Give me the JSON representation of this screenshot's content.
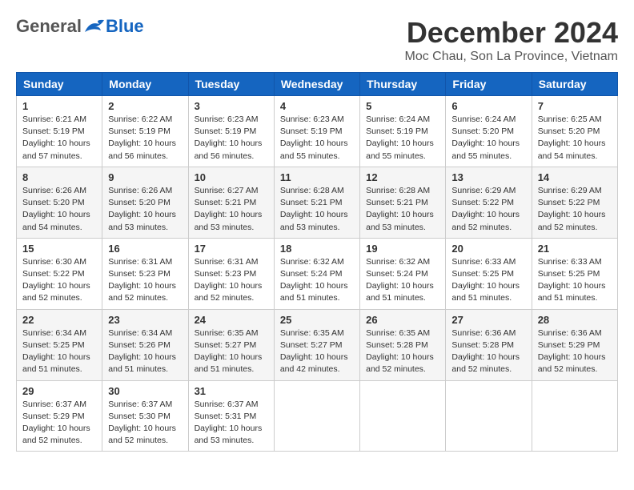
{
  "header": {
    "logo_general": "General",
    "logo_blue": "Blue",
    "title": "December 2024",
    "subtitle": "Moc Chau, Son La Province, Vietnam"
  },
  "weekdays": [
    "Sunday",
    "Monday",
    "Tuesday",
    "Wednesday",
    "Thursday",
    "Friday",
    "Saturday"
  ],
  "weeks": [
    [
      {
        "day": 1,
        "sunrise": "6:21 AM",
        "sunset": "5:19 PM",
        "daylight": "10 hours and 57 minutes."
      },
      {
        "day": 2,
        "sunrise": "6:22 AM",
        "sunset": "5:19 PM",
        "daylight": "10 hours and 56 minutes."
      },
      {
        "day": 3,
        "sunrise": "6:23 AM",
        "sunset": "5:19 PM",
        "daylight": "10 hours and 56 minutes."
      },
      {
        "day": 4,
        "sunrise": "6:23 AM",
        "sunset": "5:19 PM",
        "daylight": "10 hours and 55 minutes."
      },
      {
        "day": 5,
        "sunrise": "6:24 AM",
        "sunset": "5:19 PM",
        "daylight": "10 hours and 55 minutes."
      },
      {
        "day": 6,
        "sunrise": "6:24 AM",
        "sunset": "5:20 PM",
        "daylight": "10 hours and 55 minutes."
      },
      {
        "day": 7,
        "sunrise": "6:25 AM",
        "sunset": "5:20 PM",
        "daylight": "10 hours and 54 minutes."
      }
    ],
    [
      {
        "day": 8,
        "sunrise": "6:26 AM",
        "sunset": "5:20 PM",
        "daylight": "10 hours and 54 minutes."
      },
      {
        "day": 9,
        "sunrise": "6:26 AM",
        "sunset": "5:20 PM",
        "daylight": "10 hours and 53 minutes."
      },
      {
        "day": 10,
        "sunrise": "6:27 AM",
        "sunset": "5:21 PM",
        "daylight": "10 hours and 53 minutes."
      },
      {
        "day": 11,
        "sunrise": "6:28 AM",
        "sunset": "5:21 PM",
        "daylight": "10 hours and 53 minutes."
      },
      {
        "day": 12,
        "sunrise": "6:28 AM",
        "sunset": "5:21 PM",
        "daylight": "10 hours and 53 minutes."
      },
      {
        "day": 13,
        "sunrise": "6:29 AM",
        "sunset": "5:22 PM",
        "daylight": "10 hours and 52 minutes."
      },
      {
        "day": 14,
        "sunrise": "6:29 AM",
        "sunset": "5:22 PM",
        "daylight": "10 hours and 52 minutes."
      }
    ],
    [
      {
        "day": 15,
        "sunrise": "6:30 AM",
        "sunset": "5:22 PM",
        "daylight": "10 hours and 52 minutes."
      },
      {
        "day": 16,
        "sunrise": "6:31 AM",
        "sunset": "5:23 PM",
        "daylight": "10 hours and 52 minutes."
      },
      {
        "day": 17,
        "sunrise": "6:31 AM",
        "sunset": "5:23 PM",
        "daylight": "10 hours and 52 minutes."
      },
      {
        "day": 18,
        "sunrise": "6:32 AM",
        "sunset": "5:24 PM",
        "daylight": "10 hours and 51 minutes."
      },
      {
        "day": 19,
        "sunrise": "6:32 AM",
        "sunset": "5:24 PM",
        "daylight": "10 hours and 51 minutes."
      },
      {
        "day": 20,
        "sunrise": "6:33 AM",
        "sunset": "5:25 PM",
        "daylight": "10 hours and 51 minutes."
      },
      {
        "day": 21,
        "sunrise": "6:33 AM",
        "sunset": "5:25 PM",
        "daylight": "10 hours and 51 minutes."
      }
    ],
    [
      {
        "day": 22,
        "sunrise": "6:34 AM",
        "sunset": "5:25 PM",
        "daylight": "10 hours and 51 minutes."
      },
      {
        "day": 23,
        "sunrise": "6:34 AM",
        "sunset": "5:26 PM",
        "daylight": "10 hours and 51 minutes."
      },
      {
        "day": 24,
        "sunrise": "6:35 AM",
        "sunset": "5:27 PM",
        "daylight": "10 hours and 51 minutes."
      },
      {
        "day": 25,
        "sunrise": "6:35 AM",
        "sunset": "5:27 PM",
        "daylight": "10 hours and 42 minutes."
      },
      {
        "day": 26,
        "sunrise": "6:35 AM",
        "sunset": "5:28 PM",
        "daylight": "10 hours and 52 minutes."
      },
      {
        "day": 27,
        "sunrise": "6:36 AM",
        "sunset": "5:28 PM",
        "daylight": "10 hours and 52 minutes."
      },
      {
        "day": 28,
        "sunrise": "6:36 AM",
        "sunset": "5:29 PM",
        "daylight": "10 hours and 52 minutes."
      }
    ],
    [
      {
        "day": 29,
        "sunrise": "6:37 AM",
        "sunset": "5:29 PM",
        "daylight": "10 hours and 52 minutes."
      },
      {
        "day": 30,
        "sunrise": "6:37 AM",
        "sunset": "5:30 PM",
        "daylight": "10 hours and 52 minutes."
      },
      {
        "day": 31,
        "sunrise": "6:37 AM",
        "sunset": "5:31 PM",
        "daylight": "10 hours and 53 minutes."
      },
      null,
      null,
      null,
      null
    ]
  ]
}
